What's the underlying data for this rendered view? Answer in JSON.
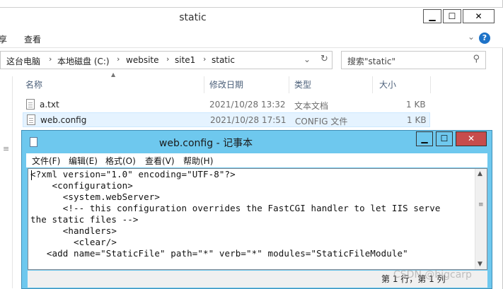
{
  "explorer": {
    "title": "static",
    "window_buttons": {
      "minimize": "▁",
      "maximize": "☐",
      "close": "✕"
    },
    "ribbon": {
      "left_fragment": "享",
      "view_tab": "查看",
      "expand": "⌄",
      "help": "?"
    },
    "breadcrumbs": [
      "这台电脑",
      "本地磁盘 (C:)",
      "website",
      "site1",
      "static"
    ],
    "search_placeholder": "搜索\"static\"",
    "columns": [
      "名称",
      "修改日期",
      "类型",
      "大小"
    ],
    "files": [
      {
        "name": "a.txt",
        "modified": "2021/10/28 13:32",
        "type": "文本文档",
        "size": "1 KB",
        "selected": false
      },
      {
        "name": "web.config",
        "modified": "2021/10/28 17:51",
        "type": "CONFIG 文件",
        "size": "1 KB",
        "selected": true
      }
    ]
  },
  "notepad": {
    "title": "web.config - 记事本",
    "menu": [
      "文件(F)",
      "编辑(E)",
      "格式(O)",
      "查看(V)",
      "帮助(H)"
    ],
    "lines": [
      "<?xml version=\"1.0\" encoding=\"UTF-8\"?>",
      "    <configuration>",
      "      <system.webServer>",
      "      <!-- this configuration overrides the FastCGI handler to let IIS serve",
      "the static files -->",
      "      <handlers>",
      "        <clear/>",
      "   <add name=\"StaticFile\" path=\"*\" verb=\"*\" modules=\"StaticFileModule\""
    ],
    "status": "第 1 行，第 1 列"
  },
  "watermark": "CSDN @bigcarp",
  "colors": {
    "notepad_title": "#6ec8ee",
    "close_button": "#c74c4c",
    "selected_row": "#e5f3ff"
  }
}
